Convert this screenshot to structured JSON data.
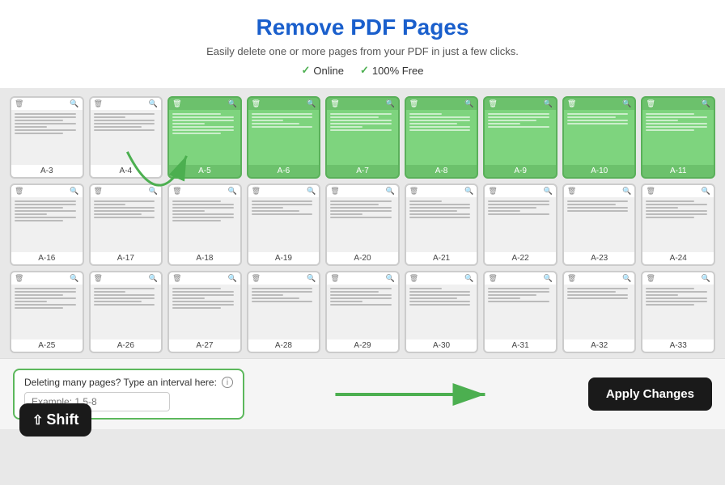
{
  "header": {
    "title": "Remove PDF Pages",
    "subtitle": "Easily delete one or more pages from your PDF in just a few clicks.",
    "badge1": "Online",
    "badge2": "100% Free"
  },
  "pages": [
    {
      "id": "A-3",
      "selected": false,
      "row": 1
    },
    {
      "id": "A-4",
      "selected": false,
      "row": 1
    },
    {
      "id": "A-5",
      "selected": true,
      "row": 1
    },
    {
      "id": "A-6",
      "selected": true,
      "row": 1
    },
    {
      "id": "A-7",
      "selected": true,
      "row": 1
    },
    {
      "id": "A-8",
      "selected": true,
      "row": 1
    },
    {
      "id": "A-9",
      "selected": true,
      "row": 1
    },
    {
      "id": "A-10",
      "selected": true,
      "row": 1
    },
    {
      "id": "A-11",
      "selected": true,
      "row": 1
    },
    {
      "id": "A-16",
      "selected": false,
      "row": 2
    },
    {
      "id": "A-17",
      "selected": false,
      "row": 2
    },
    {
      "id": "A-18",
      "selected": false,
      "row": 2
    },
    {
      "id": "A-19",
      "selected": false,
      "row": 2
    },
    {
      "id": "A-20",
      "selected": false,
      "row": 2
    },
    {
      "id": "A-21",
      "selected": false,
      "row": 2
    },
    {
      "id": "A-22",
      "selected": false,
      "row": 2
    },
    {
      "id": "A-23",
      "selected": false,
      "row": 2
    },
    {
      "id": "A-24",
      "selected": false,
      "row": 2
    },
    {
      "id": "A-25",
      "selected": false,
      "row": 3
    },
    {
      "id": "A-26",
      "selected": false,
      "row": 3
    },
    {
      "id": "A-27",
      "selected": false,
      "row": 3
    },
    {
      "id": "A-28",
      "selected": false,
      "row": 3
    },
    {
      "id": "A-29",
      "selected": false,
      "row": 3
    },
    {
      "id": "A-30",
      "selected": false,
      "row": 3
    },
    {
      "id": "A-31",
      "selected": false,
      "row": 3
    },
    {
      "id": "A-32",
      "selected": false,
      "row": 3
    },
    {
      "id": "A-33",
      "selected": false,
      "row": 3
    }
  ],
  "shift_key": "⇧Shift",
  "bottom": {
    "interval_label": "Deleting many pages? Type an interval here:",
    "interval_placeholder": "Example: 1,5-8",
    "apply_label": "Apply Changes"
  }
}
